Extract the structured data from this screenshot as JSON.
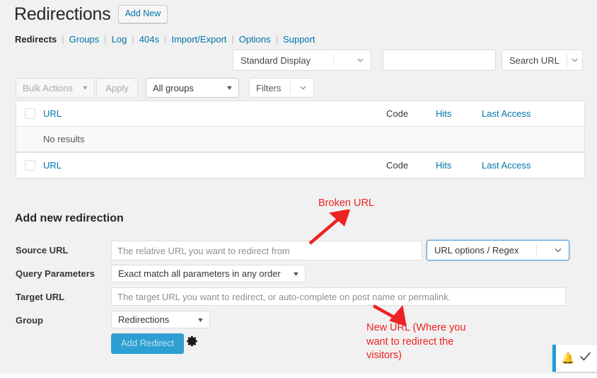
{
  "header": {
    "title": "Redirections",
    "add_new_label": "Add New"
  },
  "subnav": {
    "items": [
      {
        "label": "Redirects",
        "current": true
      },
      {
        "label": "Groups",
        "current": false
      },
      {
        "label": "Log",
        "current": false
      },
      {
        "label": "404s",
        "current": false
      },
      {
        "label": "Import/Export",
        "current": false
      },
      {
        "label": "Options",
        "current": false
      },
      {
        "label": "Support",
        "current": false
      }
    ],
    "separator": "|"
  },
  "topbar": {
    "display_select_value": "Standard Display",
    "search_value": "",
    "search_placeholder": "",
    "search_select_value": "Search URL"
  },
  "bulkbar": {
    "bulk_actions_value": "Bulk Actions",
    "apply_label": "Apply",
    "groups_value": "All groups",
    "filters_label": "Filters"
  },
  "table": {
    "columns": {
      "url": "URL",
      "code": "Code",
      "hits": "Hits",
      "last_access": "Last Access"
    },
    "empty_message": "No results"
  },
  "form": {
    "title": "Add new redirection",
    "labels": {
      "source_url": "Source URL",
      "query_parameters": "Query Parameters",
      "target_url": "Target URL",
      "group": "Group"
    },
    "source_url_value": "",
    "source_url_placeholder": "The relative URL you want to redirect from",
    "url_options_value": "URL options / Regex",
    "query_parameters_value": "Exact match all parameters in any order",
    "target_url_value": "",
    "target_url_placeholder": "The target URL you want to redirect, or auto-complete on post name or permalink.",
    "group_value": "Redirections",
    "submit_label": "Add Redirect",
    "gear_icon": "gear-icon"
  },
  "annotations": {
    "broken_url": "Broken URL",
    "new_url": "New URL (Where you want to redirect the visitors)",
    "color": "#ee2222"
  },
  "notice_widget": {
    "bell_icon": "bell-icon",
    "check_icon": "check-icon",
    "accent_color": "#1f9fd8"
  }
}
